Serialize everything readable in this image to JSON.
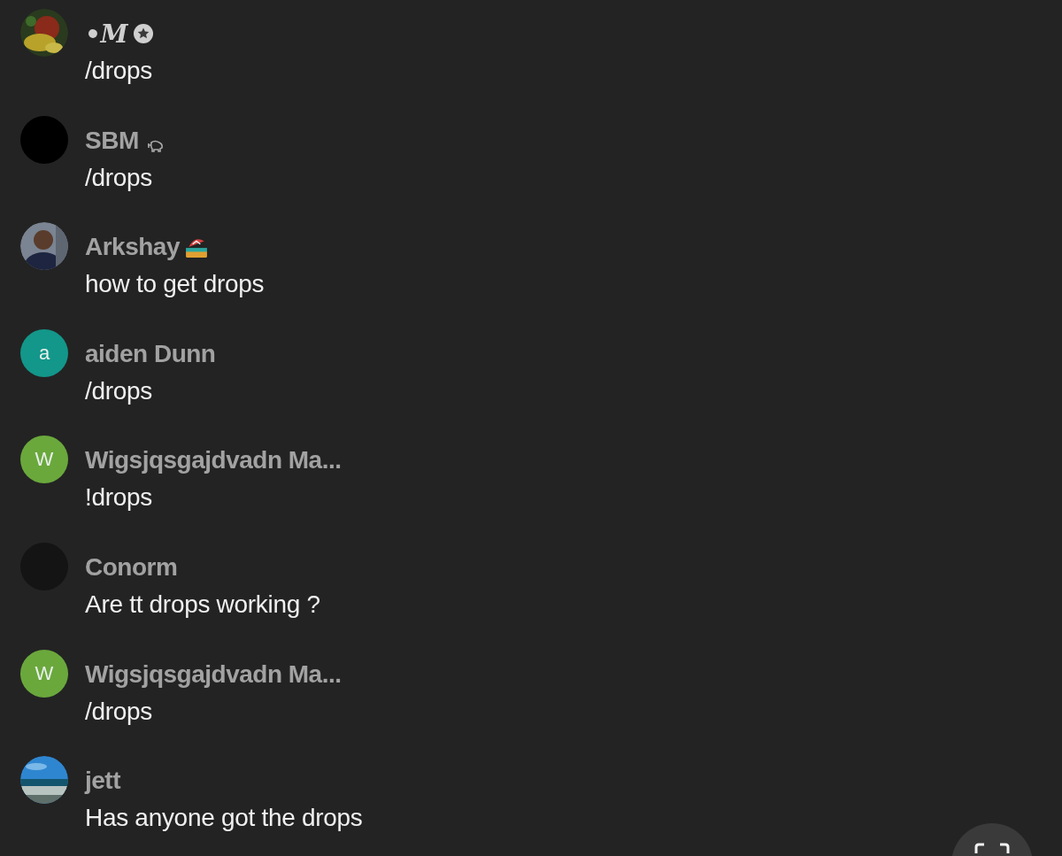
{
  "messages": [
    {
      "name": "•M",
      "kind": "fancy",
      "badge": {
        "kind": "star"
      },
      "text": "/drops"
    },
    {
      "name": "SBM",
      "kind": "plain",
      "badge": {
        "kind": "pig"
      },
      "avatar": {
        "kind": "plain",
        "color": "#000000"
      },
      "text": "/drops"
    },
    {
      "name": "Arkshay",
      "kind": "plain",
      "badge": {
        "kind": "beach"
      },
      "text": "how to get drops"
    },
    {
      "name": "aiden Dunn",
      "kind": "plain",
      "avatar": {
        "kind": "letter",
        "letter": "a",
        "color": "#12978a"
      },
      "text": "/drops"
    },
    {
      "name": "Wigsjqsgajdvadn Ma...",
      "kind": "plain",
      "avatar": {
        "kind": "letter",
        "letter": "W",
        "color": "#6aa83c"
      },
      "text": "!drops"
    },
    {
      "name": "Conorm",
      "kind": "plain",
      "avatar": {
        "kind": "plain",
        "color": "#141414"
      },
      "text": "Are tt drops working ?"
    },
    {
      "name": "Wigsjqsgajdvadn Ma...",
      "kind": "plain",
      "avatar": {
        "kind": "letter",
        "letter": "W",
        "color": "#6aa83c"
      },
      "text": "/drops"
    },
    {
      "name": "jett",
      "kind": "plain",
      "text": "Has anyone got the drops"
    }
  ]
}
